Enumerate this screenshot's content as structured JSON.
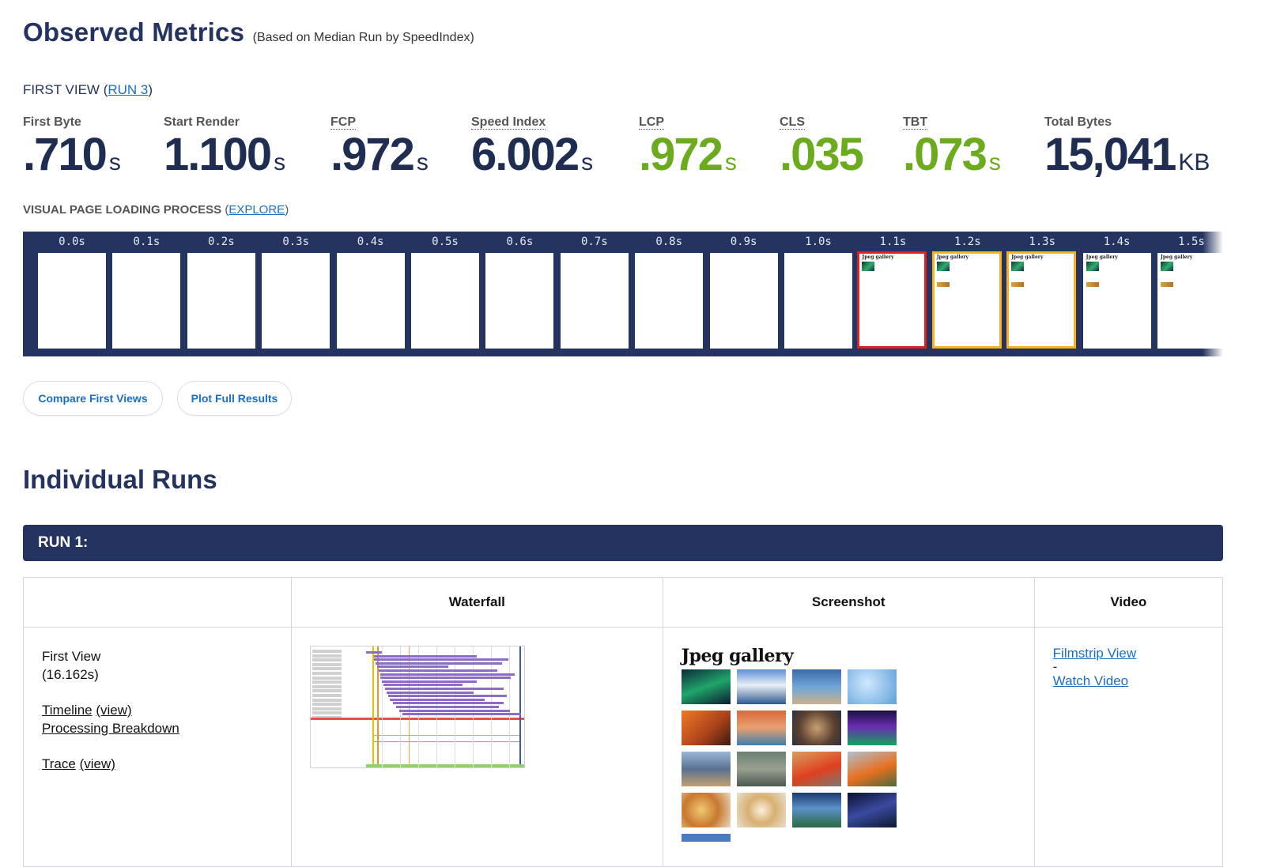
{
  "header": {
    "title": "Observed Metrics",
    "subtitle": "(Based on Median Run by SpeedIndex)",
    "first_view_prefix": "FIRST VIEW (",
    "first_view_link": "RUN 3",
    "first_view_suffix": ")"
  },
  "metrics": [
    {
      "label": "First Byte",
      "value": ".710",
      "unit": "s",
      "status": "neutral"
    },
    {
      "label": "Start Render",
      "value": "1.100",
      "unit": "s",
      "status": "neutral"
    },
    {
      "label": "FCP",
      "value": ".972",
      "unit": "s",
      "status": "neutral"
    },
    {
      "label": "Speed Index",
      "value": "6.002",
      "unit": "s",
      "status": "neutral"
    },
    {
      "label": "LCP",
      "value": ".972",
      "unit": "s",
      "status": "good"
    },
    {
      "label": "CLS",
      "value": ".035",
      "unit": "",
      "status": "good"
    },
    {
      "label": "TBT",
      "value": ".073",
      "unit": "s",
      "status": "good"
    },
    {
      "label": "Total Bytes",
      "value": "15,041",
      "unit": "KB",
      "status": "neutral"
    }
  ],
  "visual": {
    "heading": "VISUAL PAGE LOADING PROCESS",
    "open_paren": "(",
    "link": "EXPLORE",
    "close_paren": ")"
  },
  "filmstrip": {
    "frames": [
      {
        "time": "0.0s",
        "state": "blank"
      },
      {
        "time": "0.1s",
        "state": "blank"
      },
      {
        "time": "0.2s",
        "state": "blank"
      },
      {
        "time": "0.3s",
        "state": "blank"
      },
      {
        "time": "0.4s",
        "state": "blank"
      },
      {
        "time": "0.5s",
        "state": "blank"
      },
      {
        "time": "0.6s",
        "state": "blank"
      },
      {
        "time": "0.7s",
        "state": "blank"
      },
      {
        "time": "0.8s",
        "state": "blank"
      },
      {
        "time": "0.9s",
        "state": "blank"
      },
      {
        "time": "1.0s",
        "state": "blank"
      },
      {
        "time": "1.1s",
        "state": "changed-red"
      },
      {
        "time": "1.2s",
        "state": "changed-yellow"
      },
      {
        "time": "1.3s",
        "state": "changed-yellow"
      },
      {
        "time": "1.4s",
        "state": "content"
      },
      {
        "time": "1.5s",
        "state": "content"
      }
    ],
    "frame_caption": "Jpeg gallery"
  },
  "buttons": {
    "compare": "Compare First Views",
    "plot": "Plot Full Results"
  },
  "runs": {
    "section_title": "Individual Runs",
    "run_label": "RUN 1:",
    "columns": [
      "",
      "Waterfall",
      "Screenshot",
      "Video"
    ],
    "first_view_label": "First View",
    "first_view_time": "(16.162s)",
    "timeline": "Timeline",
    "view": "(view)",
    "processing": "Processing Breakdown",
    "trace": "Trace",
    "filmstrip_link": "Filmstrip View",
    "dash": "-",
    "video_link": "Watch Video",
    "screenshot_title": "Jpeg gallery"
  },
  "colors": {
    "navy": "#24335f",
    "good_green": "#6cab1e",
    "link_blue": "#1a6fc4",
    "frame_red": "#e0201c",
    "frame_yellow": "#f5b21e"
  }
}
